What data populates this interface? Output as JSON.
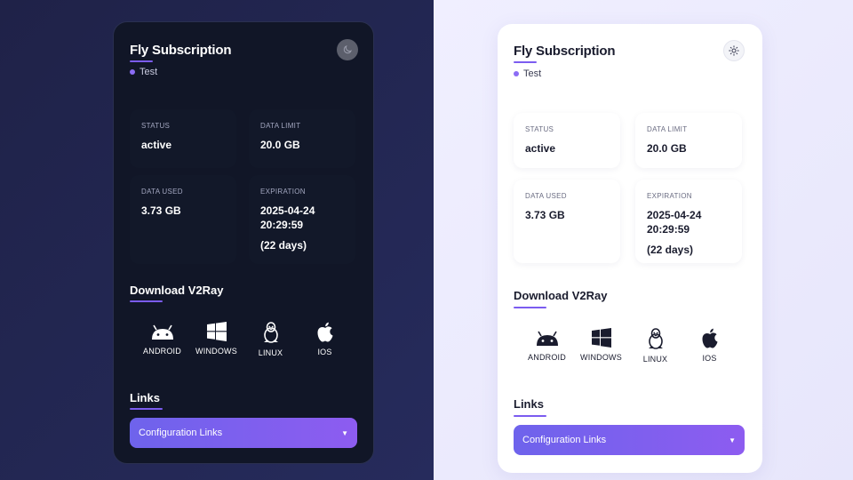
{
  "title": "Fly Subscription",
  "environment": "Test",
  "stats": {
    "status": {
      "label": "STATUS",
      "value": "active"
    },
    "data_limit": {
      "label": "DATA LIMIT",
      "value": "20.0 GB"
    },
    "data_used": {
      "label": "DATA USED",
      "value": "3.73 GB"
    },
    "expiration": {
      "label": "EXPIRATION",
      "date": "2025-04-24",
      "time": "20:29:59",
      "remaining": "(22 days)"
    }
  },
  "download": {
    "heading": "Download V2Ray",
    "platforms": [
      {
        "label": "ANDROID",
        "icon": "android-icon"
      },
      {
        "label": "WINDOWS",
        "icon": "windows-icon"
      },
      {
        "label": "LINUX",
        "icon": "linux-icon"
      },
      {
        "label": "IOS",
        "icon": "apple-icon"
      }
    ]
  },
  "links": {
    "heading": "Links",
    "dropdown_label": "Configuration Links",
    "dropdown_arrow": "▼"
  },
  "themes": {
    "dark": {
      "toggle_icon": "moon-icon"
    },
    "light": {
      "toggle_icon": "sun-icon"
    }
  },
  "colors": {
    "accent": "#7b5cf0",
    "dark_card": "#111627",
    "light_card": "#ffffff",
    "button_gradient_start": "#6e63ec",
    "button_gradient_end": "#8d5cf0"
  }
}
